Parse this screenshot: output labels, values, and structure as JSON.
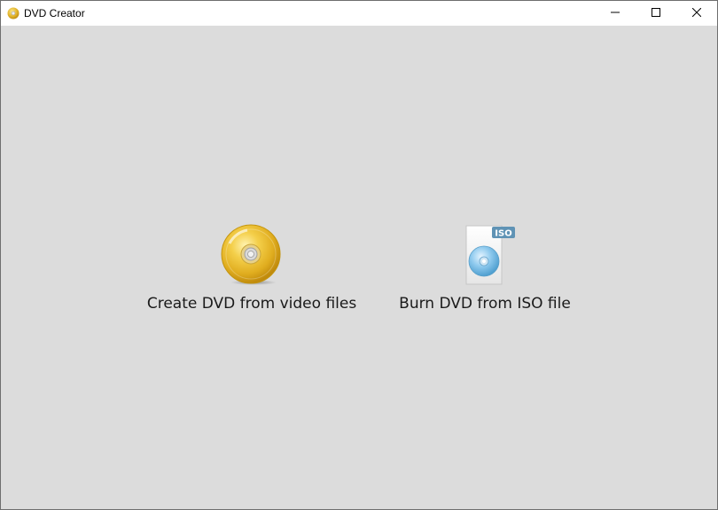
{
  "window": {
    "title": "DVD Creator",
    "controls": {
      "minimize": "minimize-icon",
      "maximize": "maximize-icon",
      "close": "close-icon"
    }
  },
  "actions": [
    {
      "label": "Create DVD from video files",
      "icon": "gold-dvd-disc-icon"
    },
    {
      "label": "Burn DVD from ISO file",
      "icon": "iso-file-icon",
      "badge": "ISO"
    }
  ],
  "colors": {
    "background": "#dcdcdc",
    "titlebar": "#ffffff",
    "disc_gold": "#e8b923",
    "disc_blue": "#6fb6df",
    "iso_badge": "#5b8fb0"
  }
}
